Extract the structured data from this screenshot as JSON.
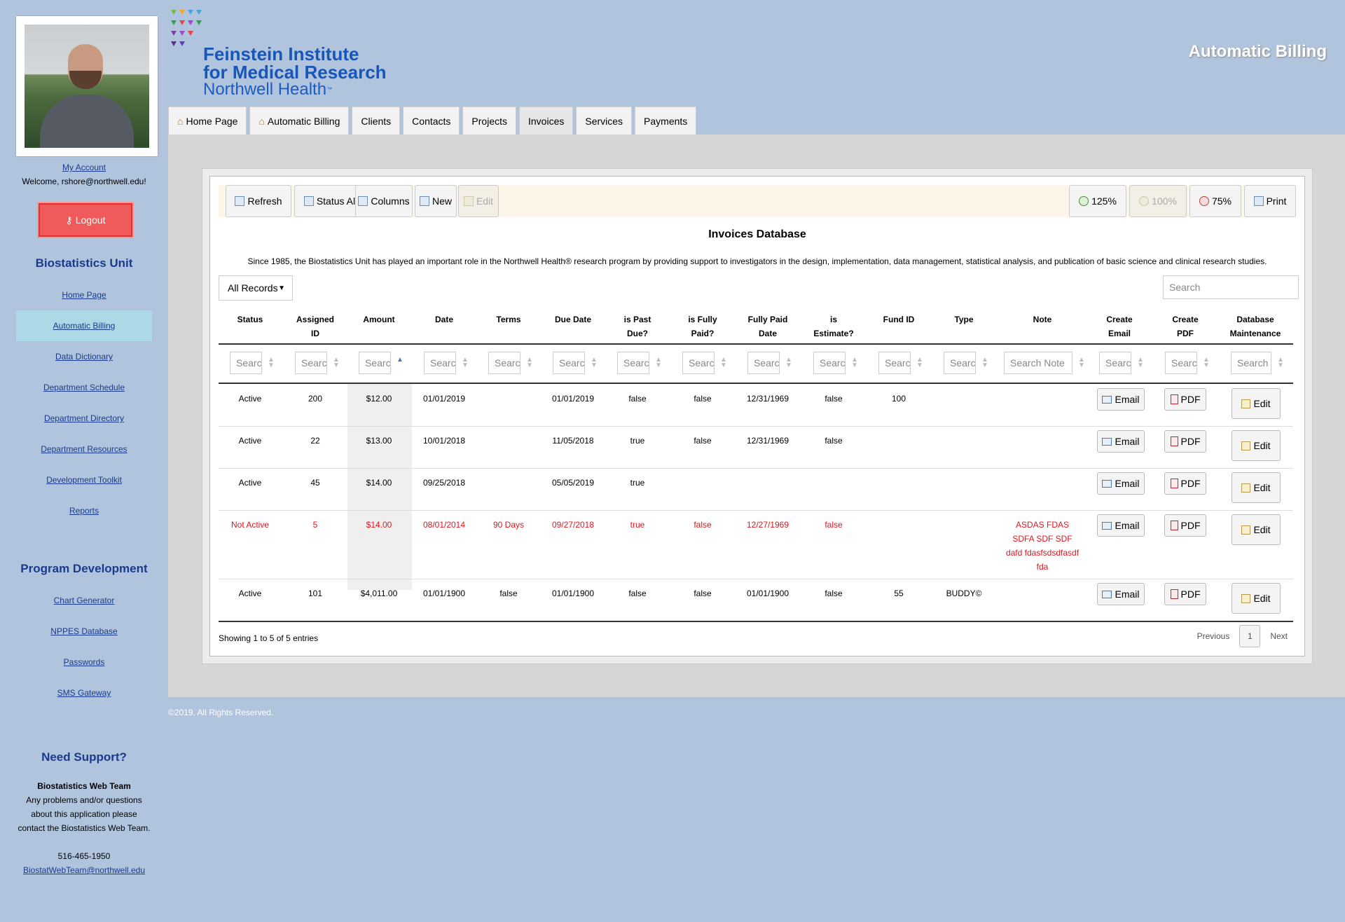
{
  "sidebar": {
    "my_account": "My Account",
    "welcome": "Welcome, rshore@northwell.edu!",
    "logout_label": "Logout",
    "unit_heading": "Biostatistics Unit",
    "unit_links": [
      "Home Page",
      "Automatic Billing",
      "Data Dictionary",
      "Department Schedule",
      "Department Directory",
      "Department Resources",
      "Development Toolkit",
      "Reports"
    ],
    "active_link": "Automatic Billing",
    "program_heading": "Program Development",
    "program_links": [
      "Chart Generator",
      "NPPES Database",
      "Passwords",
      "SMS Gateway"
    ],
    "support": {
      "heading": "Need Support?",
      "team": "Biostatistics Web Team",
      "lines": [
        "Any problems and/or questions",
        "about this application please",
        "contact the Biostatistics Web Team."
      ],
      "phone": "516-465-1950",
      "email": "BiostatWebTeam@northwell.edu"
    }
  },
  "header": {
    "logo_line1": "Feinstein Institute",
    "logo_line2": "for Medical Research",
    "logo_line3": "Northwell Health",
    "logo_tm": "™",
    "app_title": "Automatic Billing"
  },
  "tabs": [
    {
      "label": "Home Page",
      "icon": "home-icon"
    },
    {
      "label": "Automatic Billing",
      "icon": "home-icon"
    },
    {
      "label": "Clients"
    },
    {
      "label": "Contacts"
    },
    {
      "label": "Projects"
    },
    {
      "label": "Invoices"
    },
    {
      "label": "Services"
    },
    {
      "label": "Payments"
    }
  ],
  "toolbar": {
    "refresh": "Refresh",
    "status_all": "Status All",
    "columns": "Columns",
    "new": "New",
    "edit": "Edit",
    "zoom125": "125%",
    "zoom100": "100%",
    "zoom75": "75%",
    "print": "Print"
  },
  "main": {
    "title": "Invoices Database",
    "description": "Since 1985, the Biostatistics Unit has played an important role in the Northwell Health® research program by providing support to investigators in the design, implementation, data management, statistical analysis, and publication of basic science and clinical research studies.",
    "records_select": "All Records",
    "search_placeholder": "Search"
  },
  "table": {
    "headers": [
      [
        "Status",
        ""
      ],
      [
        "Assigned",
        "ID"
      ],
      [
        "Amount",
        ""
      ],
      [
        "Date",
        ""
      ],
      [
        "Terms",
        ""
      ],
      [
        "Due Date",
        ""
      ],
      [
        "is Past",
        "Due?"
      ],
      [
        "is Fully",
        "Paid?"
      ],
      [
        "Fully Paid",
        "Date"
      ],
      [
        "is",
        "Estimate?"
      ],
      [
        "Fund ID",
        ""
      ],
      [
        "Type",
        ""
      ],
      [
        "Note",
        ""
      ],
      [
        "Create",
        "Email"
      ],
      [
        "Create",
        "PDF"
      ],
      [
        "Database",
        "Maintenance"
      ]
    ],
    "filters": [
      "Search",
      "Search",
      "Search",
      "Search",
      "Search",
      "Search",
      "Search",
      "Search",
      "Search",
      "Search",
      "Search",
      "Search",
      "Search Note",
      "Search",
      "Search",
      "Search D"
    ],
    "rows": [
      {
        "status": "Active",
        "id": "200",
        "amount": "$12.00",
        "date": "01/01/2019",
        "terms": "",
        "due": "01/01/2019",
        "past": "false",
        "paid": "false",
        "paid_date": "12/31/1969",
        "estimate": "false",
        "fund": "100",
        "type": "",
        "note": [],
        "red": false
      },
      {
        "status": "Active",
        "id": "22",
        "amount": "$13.00",
        "date": "10/01/2018",
        "terms": "",
        "due": "11/05/2018",
        "past": "true",
        "paid": "false",
        "paid_date": "12/31/1969",
        "estimate": "false",
        "fund": "",
        "type": "",
        "note": [],
        "red": false
      },
      {
        "status": "Active",
        "id": "45",
        "amount": "$14.00",
        "date": "09/25/2018",
        "terms": "",
        "due": "05/05/2019",
        "past": "true",
        "paid": "",
        "paid_date": "",
        "estimate": "",
        "fund": "",
        "type": "",
        "note": [],
        "red": false
      },
      {
        "status": "Not Active",
        "id": "5",
        "amount": "$14.00",
        "date": "08/01/2014",
        "terms": "90 Days",
        "due": "09/27/2018",
        "past": "true",
        "paid": "false",
        "paid_date": "12/27/1969",
        "estimate": "false",
        "fund": "",
        "type": "",
        "note": [
          "ASDAS FDAS",
          "SDFA SDF SDF",
          "dafd fdasfsdsdfasdf",
          "fda"
        ],
        "red": true
      },
      {
        "status": "Active",
        "id": "101",
        "amount": "$4,011.00",
        "date": "01/01/1900",
        "terms": "false",
        "due": "01/01/1900",
        "past": "false",
        "paid": "false",
        "paid_date": "01/01/1900",
        "estimate": "false",
        "fund": "55",
        "type": "BUDDY©",
        "note": [],
        "red": false
      }
    ],
    "email_label": "Email",
    "pdf_label": "PDF",
    "edit_label": "Edit"
  },
  "pagination": {
    "info": "Showing 1 to 5 of 5 entries",
    "previous": "Previous",
    "page": "1",
    "next": "Next"
  },
  "footer": "©2019. All Rights Reserved.",
  "colors": {
    "background": "#b0c4de",
    "accent": "#1a3a8c",
    "logout": "#f05a5a",
    "inactive_row": "#e0161f"
  }
}
